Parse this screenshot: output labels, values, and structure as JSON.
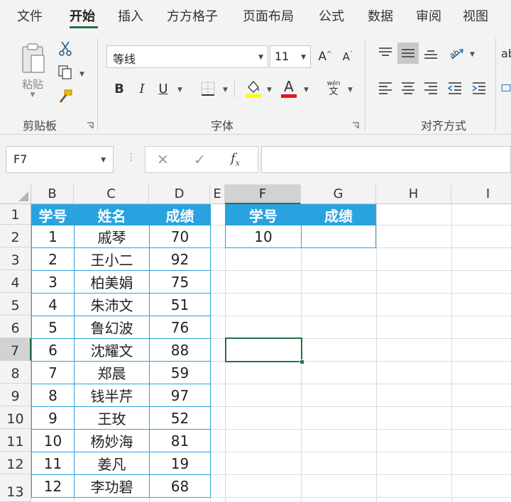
{
  "menu": {
    "tabs": [
      "文件",
      "开始",
      "插入",
      "方方格子",
      "页面布局",
      "公式",
      "数据",
      "审阅",
      "视图"
    ],
    "active_index": 1
  },
  "ribbon": {
    "clipboard": {
      "paste_label": "粘贴",
      "group_label": "剪贴板"
    },
    "font": {
      "font_name": "等线",
      "font_size": "11",
      "group_label": "字体",
      "bold": "B",
      "italic": "I",
      "underline": "U",
      "font_color": "A",
      "phonetic_top": "wén",
      "phonetic_bottom": "文"
    },
    "alignment": {
      "group_label": "对齐方式"
    }
  },
  "formula_bar": {
    "name_box": "F7",
    "formula": ""
  },
  "grid": {
    "columns": [
      "B",
      "C",
      "D",
      "E",
      "F",
      "G",
      "H",
      "I"
    ],
    "selected_column": "F",
    "rows": [
      "1",
      "2",
      "3",
      "4",
      "5",
      "6",
      "7",
      "8",
      "9",
      "10",
      "11",
      "12",
      "13"
    ],
    "selected_row": "7",
    "main_table": {
      "headers": [
        "学号",
        "姓名",
        "成绩"
      ],
      "rows": [
        [
          "1",
          "戚琴",
          "70"
        ],
        [
          "2",
          "王小二",
          "92"
        ],
        [
          "3",
          "柏美娟",
          "75"
        ],
        [
          "4",
          "朱沛文",
          "51"
        ],
        [
          "5",
          "鲁幻波",
          "76"
        ],
        [
          "6",
          "沈耀文",
          "88"
        ],
        [
          "7",
          "郑晨",
          "59"
        ],
        [
          "8",
          "钱半芹",
          "97"
        ],
        [
          "9",
          "王玫",
          "52"
        ],
        [
          "10",
          "杨妙海",
          "81"
        ],
        [
          "11",
          "姜凡",
          "19"
        ],
        [
          "12",
          "李功碧",
          "68"
        ]
      ]
    },
    "lookup_table": {
      "headers": [
        "学号",
        "成绩"
      ],
      "values": [
        "10",
        ""
      ]
    },
    "selected_cell": "F7"
  },
  "colors": {
    "header_fill": "#29a3df",
    "selection": "#217346"
  }
}
